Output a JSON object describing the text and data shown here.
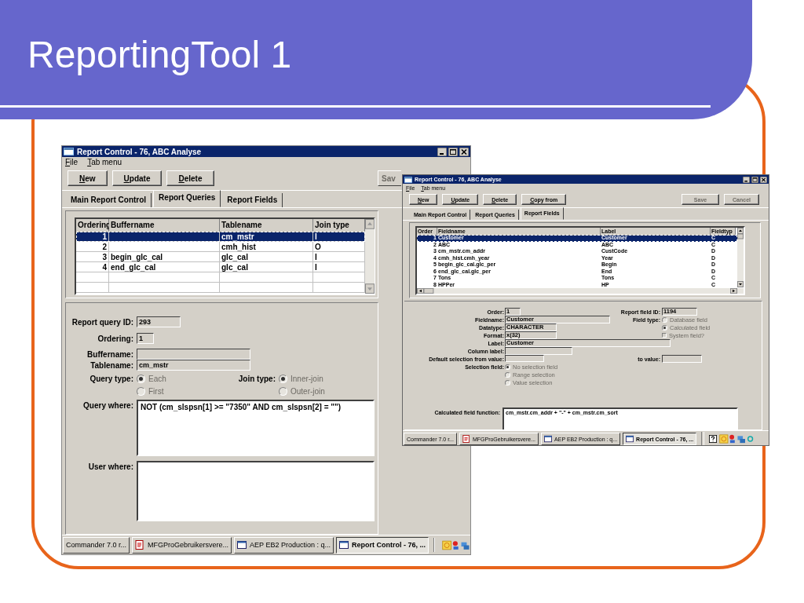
{
  "slide_title": "ReportingTool 1",
  "queries_window": {
    "title": "Report Control - 76, ABC Analyse",
    "menu": [
      "File",
      "Tab menu"
    ],
    "toolbar": [
      {
        "label": "New",
        "disabled": false
      },
      {
        "label": "Update",
        "disabled": false
      },
      {
        "label": "Delete",
        "disabled": false
      },
      {
        "label": "Sav",
        "disabled": true
      }
    ],
    "tabs": [
      {
        "label": "Main Report Control",
        "selected": false
      },
      {
        "label": "Report Queries",
        "selected": true
      },
      {
        "label": "Report Fields",
        "selected": false
      }
    ],
    "table": {
      "columns": [
        "Ordering",
        "Buffername",
        "Tablename",
        "Join type"
      ],
      "rows": [
        {
          "ordering": "1",
          "tablename": "cm_mstr",
          "join_type": "I",
          "selected": true
        },
        {
          "ordering": "2",
          "tablename": "cmh_hist",
          "join_type": "O",
          "selected": false
        },
        {
          "ordering": "3",
          "buffername": "begin_glc_cal",
          "tablename": "glc_cal",
          "join_type": "I",
          "selected": false
        },
        {
          "ordering": "4",
          "buffername": "end_glc_cal",
          "tablename": "glc_cal",
          "join_type": "I",
          "selected": false
        }
      ]
    },
    "form": {
      "report_query_id": {
        "label": "Report query ID:",
        "value": "293"
      },
      "ordering": {
        "label": "Ordering:",
        "value": "1"
      },
      "buffername": {
        "label": "Buffername:"
      },
      "tablename": {
        "label": "Tablename:",
        "value": "cm_mstr"
      },
      "query_type": {
        "label": "Query type:",
        "disabled": true,
        "options": [
          {
            "label": "Each",
            "selected": true
          },
          {
            "label": "First",
            "selected": false
          }
        ]
      },
      "join_type": {
        "label": "Join type:",
        "disabled": true,
        "options": [
          {
            "label": "Inner-join",
            "selected": true
          },
          {
            "label": "Outer-join",
            "selected": false
          }
        ]
      },
      "query_where": {
        "label": "Query where:",
        "value": "NOT (cm_slspsn[1] >= \"7350\" AND cm_slspsn[2] = \"\")"
      },
      "user_where": {
        "label": "User where:"
      }
    },
    "taskbar": [
      {
        "label": "Commander 7.0 r...",
        "kind": "plain",
        "selected": false
      },
      {
        "label": "MFGProGebruikersvere...",
        "kind": "document",
        "selected": false
      },
      {
        "label": "AEP EB2 Production : q...",
        "kind": "window",
        "selected": false
      },
      {
        "label": "Report Control - 76, ...",
        "kind": "window",
        "selected": true
      }
    ]
  },
  "fields_window": {
    "title": "Report Control - 76, ABC Analyse",
    "menu": [
      "File",
      "Tab menu"
    ],
    "toolbar": [
      {
        "label": "New",
        "disabled": false
      },
      {
        "label": "Update",
        "disabled": false
      },
      {
        "label": "Delete",
        "disabled": false
      },
      {
        "label": "Copy from",
        "disabled": false
      },
      {
        "label": "Save",
        "disabled": true
      },
      {
        "label": "Cancel",
        "disabled": true
      }
    ],
    "tabs": [
      {
        "label": "Main Report Control",
        "selected": false
      },
      {
        "label": "Report Queries",
        "selected": false
      },
      {
        "label": "Report Fields",
        "selected": true
      }
    ],
    "table": {
      "columns": [
        "Order",
        "Fieldname",
        "Label",
        "Fieldtyp"
      ],
      "rows": [
        {
          "order": "1",
          "fieldname": "Customer",
          "label": "Customer",
          "fieldtype": "C",
          "selected": true
        },
        {
          "order": "2",
          "fieldname": "ABC",
          "label": "ABC",
          "fieldtype": "C",
          "selected": false
        },
        {
          "order": "3",
          "fieldname": "cm_mstr.cm_addr",
          "label": "CustCode",
          "fieldtype": "D",
          "selected": false
        },
        {
          "order": "4",
          "fieldname": "cmh_hist.cmh_year",
          "label": "Year",
          "fieldtype": "D",
          "selected": false
        },
        {
          "order": "5",
          "fieldname": "begin_glc_cal.glc_per",
          "label": "Begin",
          "fieldtype": "D",
          "selected": false
        },
        {
          "order": "6",
          "fieldname": "end_glc_cal.glc_per",
          "label": "End",
          "fieldtype": "D",
          "selected": false
        },
        {
          "order": "7",
          "fieldname": "Tons",
          "label": "Tons",
          "fieldtype": "C",
          "selected": false
        },
        {
          "order": "8",
          "fieldname": "HPPer",
          "label": "HP",
          "fieldtype": "C",
          "selected": false
        }
      ]
    },
    "form": {
      "order": {
        "label": "Order:",
        "value": "1"
      },
      "report_field_id": {
        "label": "Report field ID:",
        "value": "1194"
      },
      "fieldname": {
        "label": "Fieldname:",
        "value": "Customer"
      },
      "field_type": {
        "label": "Field type:",
        "disabled": true,
        "options": [
          {
            "label": "Database field",
            "selected": false
          },
          {
            "label": "Calculated field",
            "selected": true
          }
        ]
      },
      "system_field": {
        "label": "System field?",
        "checked": false,
        "disabled": true
      },
      "datatype": {
        "label": "Datatype:",
        "value": "CHARACTER"
      },
      "format": {
        "label": "Format:",
        "value": "x(32)"
      },
      "label": {
        "label": "Label:",
        "value": "Customer"
      },
      "column_label": {
        "label": "Column label:"
      },
      "default_from": {
        "label": "Default selection from value:"
      },
      "to_value": {
        "label": "to value:"
      },
      "selection_field": {
        "label": "Selection field:",
        "disabled": true,
        "options": [
          {
            "label": "No selection field",
            "selected": true
          },
          {
            "label": "Range selection",
            "selected": false
          },
          {
            "label": "Value selection",
            "selected": false
          }
        ]
      },
      "calculated_function": {
        "label": "Calculated field function:",
        "value": "cm_mstr.cm_addr + \"-\" + cm_mstr.cm_sort"
      }
    },
    "taskbar": [
      {
        "label": "Commander 7.0 r...",
        "kind": "plain",
        "selected": false
      },
      {
        "label": "MFGProGebruikersvere...",
        "kind": "document",
        "selected": false
      },
      {
        "label": "AEP EB2 Production : q...",
        "kind": "window",
        "selected": false
      },
      {
        "label": "Report Control - 76, ...",
        "kind": "window",
        "selected": true
      }
    ]
  }
}
